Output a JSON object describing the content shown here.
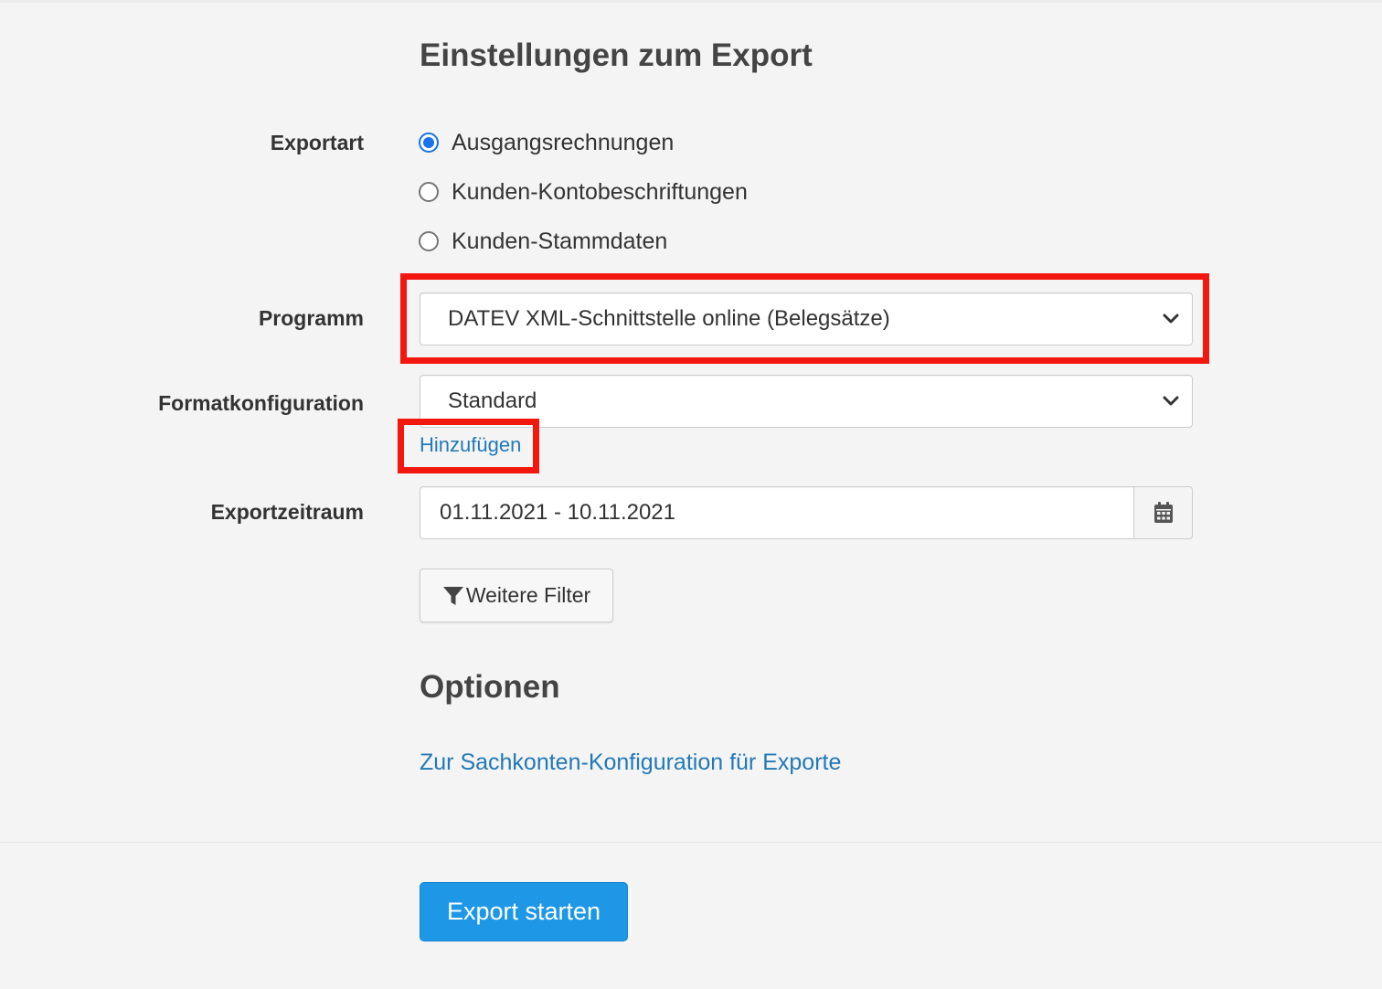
{
  "page": {
    "title": "Einstellungen zum Export"
  },
  "export_type": {
    "label": "Exportart",
    "options": [
      {
        "label": "Ausgangsrechnungen",
        "checked": true
      },
      {
        "label": "Kunden-Kontobeschriftungen",
        "checked": false
      },
      {
        "label": "Kunden-Stammdaten",
        "checked": false
      }
    ]
  },
  "program": {
    "label": "Programm",
    "selected": "DATEV XML-Schnittstelle online (Belegsätze)"
  },
  "format_config": {
    "label": "Formatkonfiguration",
    "selected": "Standard",
    "add_link": "Hinzufügen"
  },
  "export_period": {
    "label": "Exportzeitraum",
    "value": "01.11.2021 - 10.11.2021"
  },
  "filter_button": {
    "label": "Weitere Filter"
  },
  "options": {
    "heading": "Optionen",
    "link": "Zur Sachkonten-Konfiguration für Exporte"
  },
  "footer": {
    "start_button": "Export starten"
  },
  "colors": {
    "accent": "#1d97e6",
    "link": "#2279b6",
    "highlight": "#f3180f",
    "background": "#f4f4f4"
  },
  "icons": {
    "select_chevron": "chevron-down-icon",
    "calendar": "calendar-icon",
    "filter": "filter-icon"
  }
}
